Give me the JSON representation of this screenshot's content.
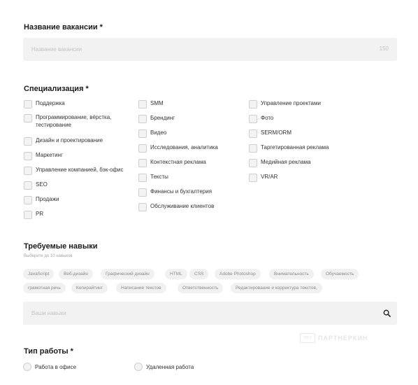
{
  "vacancy": {
    "title": "Название вакансии *",
    "placeholder": "Название вакансии",
    "value": "",
    "counter": "150"
  },
  "specialization": {
    "title": "Специализация *",
    "col1": [
      "Поддержка",
      "Программирование, вёрстка,\nтестирование",
      "Дизайн и проектирование",
      "Маркетинг",
      "Управление компанией, бэк-офис",
      "SEO",
      "Продажи",
      "PR"
    ],
    "col2": [
      "SMM",
      "Брендинг",
      "Видео",
      "Исследования, аналитика",
      "Контекстная реклама",
      "Тексты",
      "Финансы и бухгалтерия",
      "Обслуживание клиентов"
    ],
    "col3": [
      "Управление проектами",
      "Фото",
      "SERM/ORM",
      "Таргетированная реклама",
      "Медийная реклама",
      "VR/AR"
    ]
  },
  "skills": {
    "title": "Требуемые навыки",
    "hint": "Выберите до 10 навыков",
    "chips_row1": [
      "JavaScript",
      "Веб-дизайн",
      "Графический дизайн",
      "HTML",
      "CSS",
      "Adobe Photoshop",
      "Внимательность",
      "Обучаемость"
    ],
    "chips_row2": [
      "грамотная речь",
      "Копирайтинг",
      "Написание текстов",
      "Ответственность",
      "Редактирование и корректура текстов,"
    ],
    "placeholder": "Ваши навыки",
    "value": ""
  },
  "work_type": {
    "title": "Тип работы *",
    "options": [
      "Работа в офисе",
      "Удаленная работа"
    ]
  },
  "watermark": {
    "logo": "РRO",
    "text": "ПАРТНЕРКИН"
  }
}
